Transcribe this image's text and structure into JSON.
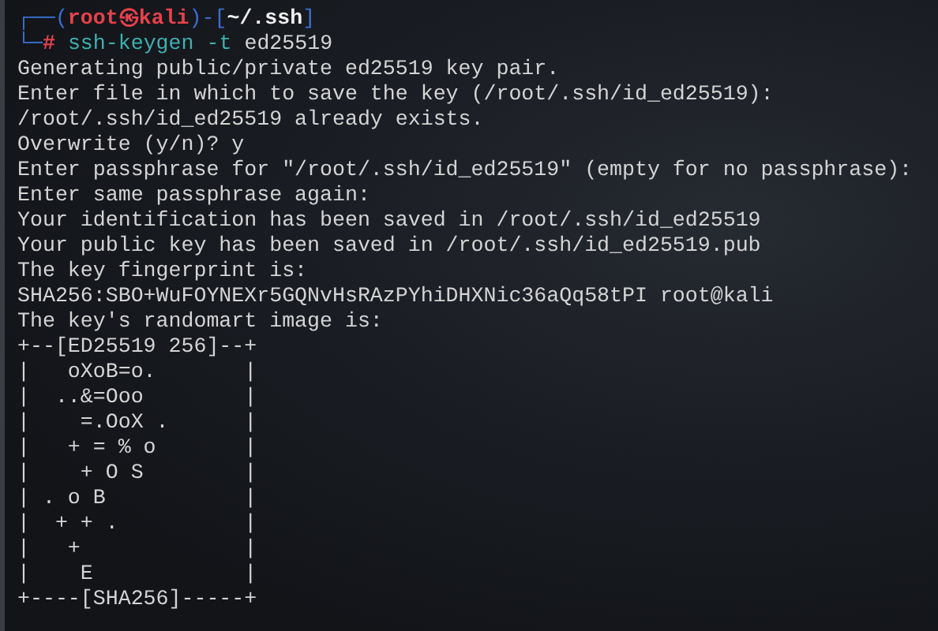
{
  "terminal": {
    "prompt": [
      {
        "text": "┌──(",
        "kind": "frame"
      },
      {
        "text": "root㉿kali",
        "kind": "user"
      },
      {
        "text": ")-[",
        "kind": "frame"
      },
      {
        "text": "~/.ssh",
        "kind": "path"
      },
      {
        "text": "]",
        "kind": "frame"
      }
    ],
    "command_line": [
      {
        "text": "└─",
        "kind": "frame"
      },
      {
        "text": "#",
        "kind": "symbol"
      },
      {
        "text": "ssh-keygen",
        "kind": "command"
      },
      {
        "text": "-t",
        "kind": "option"
      },
      {
        "text": "ed25519",
        "kind": "argument"
      }
    ],
    "output": [
      "Generating public/private ed25519 key pair.",
      "Enter file in which to save the key (/root/.ssh/id_ed25519):",
      "/root/.ssh/id_ed25519 already exists.",
      "Overwrite (y/n)? y",
      "Enter passphrase for \"/root/.ssh/id_ed25519\" (empty for no passphrase):",
      "Enter same passphrase again:",
      "Your identification has been saved in /root/.ssh/id_ed25519",
      "Your public key has been saved in /root/.ssh/id_ed25519.pub",
      "The key fingerprint is:",
      "SHA256:SBO+WuFOYNEXr5GQNvHsRAzPYhiDHXNic36aQq58tPI root@kali",
      "The key's randomart image is:"
    ],
    "randomart": [
      "+--[ED25519 256]--+",
      "|   oXoB=o.       |",
      "|  ..&=Ooo        |",
      "|    =.OoX .      |",
      "|   + = % o       |",
      "|    + O S        |",
      "| . o B           |",
      "|  + + .          |",
      "|   +             |",
      "|    E            |",
      "+----[SHA256]-----+"
    ]
  }
}
